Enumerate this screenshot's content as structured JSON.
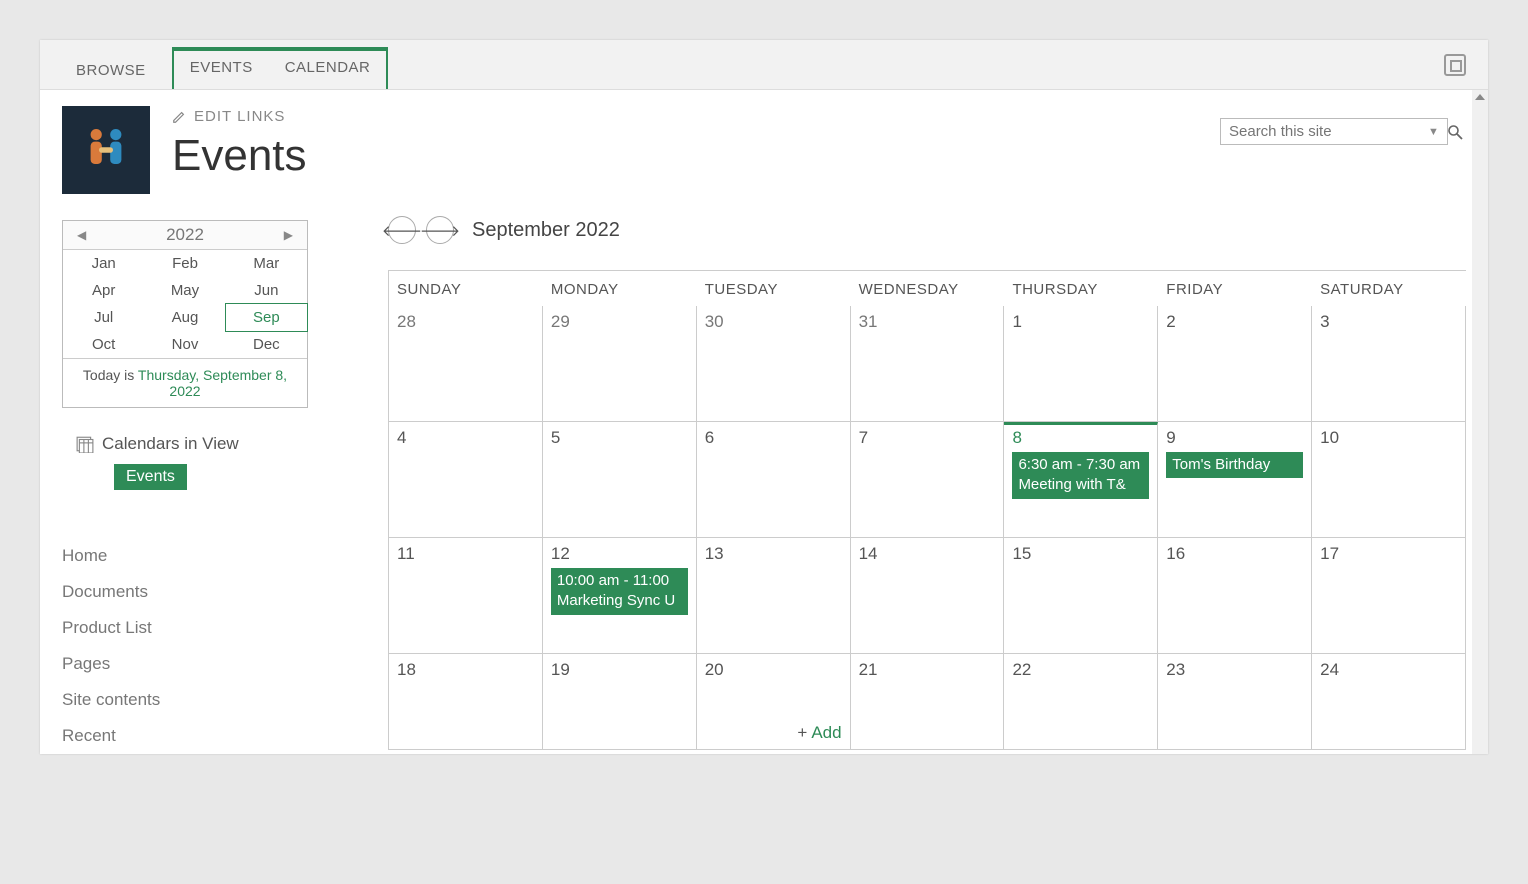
{
  "ribbon": {
    "browse": "BROWSE",
    "events": "EVENTS",
    "calendar": "CALENDAR"
  },
  "header": {
    "edit_links": "EDIT LINKS",
    "page_title": "Events"
  },
  "search": {
    "placeholder": "Search this site"
  },
  "mini_calendar": {
    "year": "2022",
    "months": [
      "Jan",
      "Feb",
      "Mar",
      "Apr",
      "May",
      "Jun",
      "Jul",
      "Aug",
      "Sep",
      "Oct",
      "Nov",
      "Dec"
    ],
    "selected_index": 8,
    "today_prefix": "Today is ",
    "today_date": "Thursday, September 8, 2022"
  },
  "calendars_in_view": {
    "label": "Calendars in View",
    "chip": "Events"
  },
  "quick_launch": [
    "Home",
    "Documents",
    "Product List",
    "Pages",
    "Site contents",
    "Recent"
  ],
  "calendar": {
    "title": "September 2022",
    "days_of_week": [
      "SUNDAY",
      "MONDAY",
      "TUESDAY",
      "WEDNESDAY",
      "THURSDAY",
      "FRIDAY",
      "SATURDAY"
    ],
    "weeks": [
      [
        {
          "day": "28",
          "outside": true
        },
        {
          "day": "29",
          "outside": true
        },
        {
          "day": "30",
          "outside": true
        },
        {
          "day": "31",
          "outside": true
        },
        {
          "day": "1"
        },
        {
          "day": "2"
        },
        {
          "day": "3"
        }
      ],
      [
        {
          "day": "4"
        },
        {
          "day": "5"
        },
        {
          "day": "6"
        },
        {
          "day": "7"
        },
        {
          "day": "8",
          "today": true,
          "events": [
            {
              "time": "6:30 am - 7:30 am",
              "title": "Meeting with T&"
            }
          ]
        },
        {
          "day": "9",
          "events": [
            {
              "title": "Tom's Birthday"
            }
          ]
        },
        {
          "day": "10"
        }
      ],
      [
        {
          "day": "11"
        },
        {
          "day": "12",
          "events": [
            {
              "time": "10:00 am - 11:00",
              "title": "Marketing Sync U"
            }
          ]
        },
        {
          "day": "13"
        },
        {
          "day": "14"
        },
        {
          "day": "15"
        },
        {
          "day": "16"
        },
        {
          "day": "17"
        }
      ],
      [
        {
          "day": "18"
        },
        {
          "day": "19"
        },
        {
          "day": "20",
          "add": true
        },
        {
          "day": "21"
        },
        {
          "day": "22"
        },
        {
          "day": "23"
        },
        {
          "day": "24"
        }
      ]
    ],
    "add_label": "Add"
  }
}
